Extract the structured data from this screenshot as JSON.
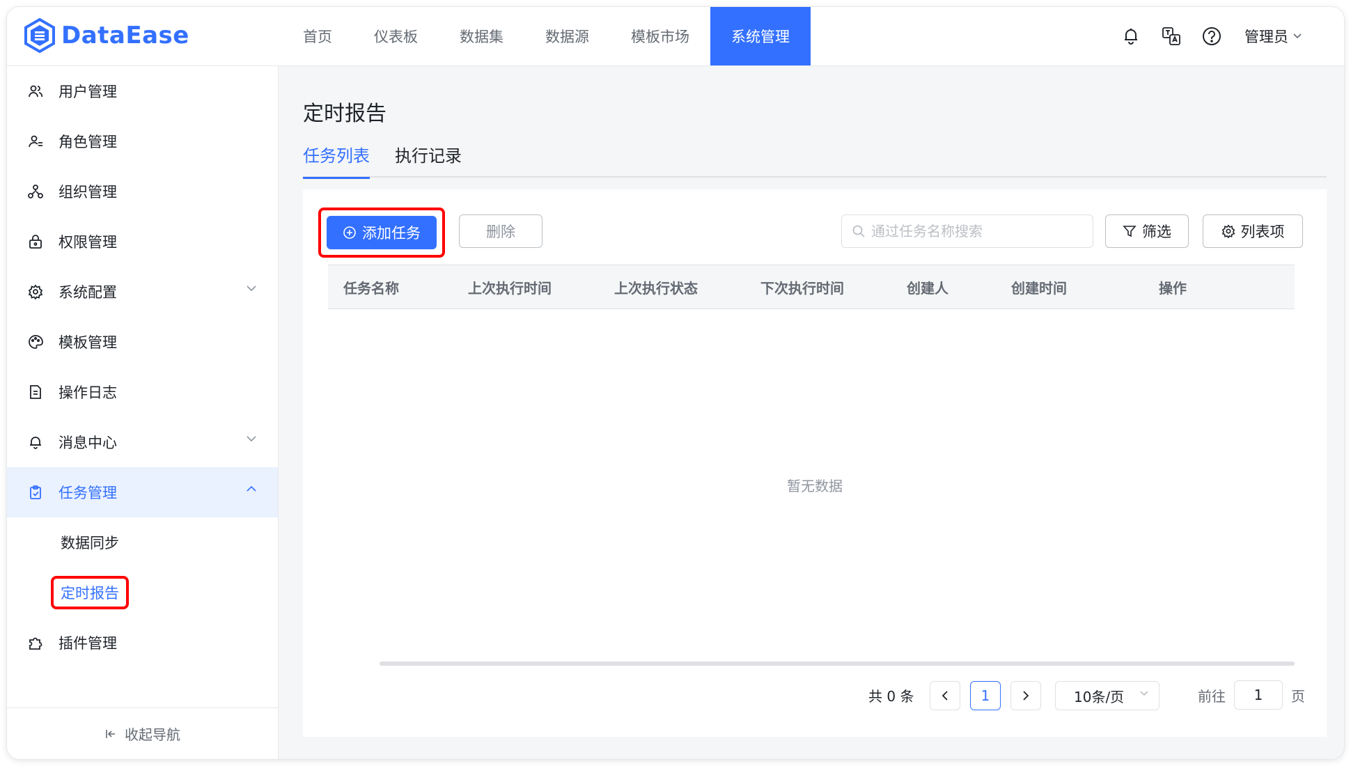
{
  "header": {
    "logo_text": "DataEase",
    "nav": [
      "首页",
      "仪表板",
      "数据集",
      "数据源",
      "模板市场",
      "系统管理"
    ],
    "active_nav_index": 5,
    "icons": [
      "bell-icon",
      "translate-icon",
      "help-icon"
    ],
    "user": "管理员"
  },
  "sidebar": {
    "items": [
      {
        "label": "用户管理",
        "icon": "users-icon"
      },
      {
        "label": "角色管理",
        "icon": "role-icon"
      },
      {
        "label": "组织管理",
        "icon": "org-icon"
      },
      {
        "label": "权限管理",
        "icon": "lock-icon"
      },
      {
        "label": "系统配置",
        "icon": "gear-icon",
        "chevron": "down"
      },
      {
        "label": "模板管理",
        "icon": "palette-icon"
      },
      {
        "label": "操作日志",
        "icon": "document-icon"
      },
      {
        "label": "消息中心",
        "icon": "bell-icon",
        "chevron": "down"
      },
      {
        "label": "任务管理",
        "icon": "clipboard-icon",
        "chevron": "up",
        "expanded": true
      },
      {
        "label": "数据同步",
        "sub": true
      },
      {
        "label": "定时报告",
        "sub": true,
        "active": true
      },
      {
        "label": "插件管理",
        "icon": "puzzle-icon"
      }
    ],
    "collapse_label": "收起导航"
  },
  "main": {
    "title": "定时报告",
    "tabs": [
      {
        "label": "任务列表",
        "active": true
      },
      {
        "label": "执行记录",
        "active": false
      }
    ],
    "toolbar": {
      "add_label": "添加任务",
      "delete_label": "删除",
      "search_placeholder": "通过任务名称搜索",
      "filter_label": "筛选",
      "columns_label": "列表项"
    },
    "table": {
      "columns": [
        "任务名称",
        "上次执行时间",
        "上次执行状态",
        "下次执行时间",
        "创建人",
        "创建时间",
        "操作"
      ],
      "empty_text": "暂无数据"
    },
    "pagination": {
      "total_text": "共 0 条",
      "current_page": "1",
      "page_size": "10条/页",
      "goto_prefix": "前往",
      "goto_value": "1",
      "goto_suffix": "页"
    }
  },
  "colors": {
    "accent": "#3370ff",
    "highlight": "#ff0000"
  }
}
